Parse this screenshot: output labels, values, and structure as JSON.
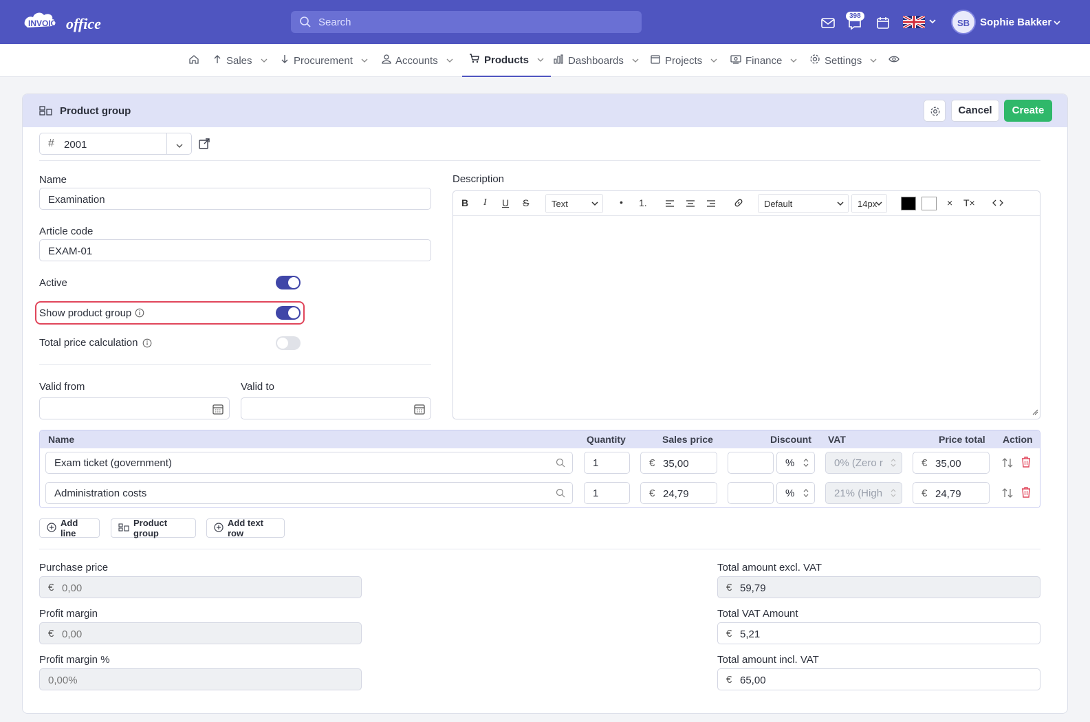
{
  "topbar": {
    "logo_text": "INVOICE office",
    "search_placeholder": "Search",
    "notification_count": "398",
    "user_initials": "SB",
    "user_name": "Sophie Bakker"
  },
  "nav": {
    "items": [
      {
        "label": "Sales"
      },
      {
        "label": "Procurement"
      },
      {
        "label": "Accounts"
      },
      {
        "label": "Products"
      },
      {
        "label": "Dashboards"
      },
      {
        "label": "Projects"
      },
      {
        "label": "Finance"
      },
      {
        "label": "Settings"
      }
    ],
    "active": "Products"
  },
  "card": {
    "title": "Product group",
    "cancel_label": "Cancel",
    "create_label": "Create"
  },
  "form": {
    "number": "2001",
    "name_label": "Name",
    "name_value": "Examination",
    "article_code_label": "Article code",
    "article_code_value": "EXAM-01",
    "active_label": "Active",
    "active_on": true,
    "show_group_label": "Show product group",
    "show_group_on": true,
    "total_price_calc_label": "Total price calculation",
    "total_price_calc_on": false,
    "valid_from_label": "Valid from",
    "valid_from_value": "",
    "valid_to_label": "Valid to",
    "valid_to_value": "",
    "description_label": "Description"
  },
  "editor": {
    "format_select": "Text",
    "font_select": "Default",
    "size_select": "14px",
    "bold": "B",
    "italic": "I",
    "underline": "U",
    "strike": "S",
    "ordered": "1.",
    "clear": "T×",
    "close": "×"
  },
  "lines": {
    "headers": {
      "name": "Name",
      "quantity": "Quantity",
      "sales_price": "Sales price",
      "discount": "Discount",
      "vat": "VAT",
      "price_total": "Price total",
      "action": "Action"
    },
    "rows": [
      {
        "name": "Exam ticket (government)",
        "quantity": "1",
        "sales_price": "35,00",
        "discount": "",
        "discount_unit": "%",
        "vat": "0% (Zero r",
        "price_total": "35,00"
      },
      {
        "name": "Administration costs",
        "quantity": "1",
        "sales_price": "24,79",
        "discount": "",
        "discount_unit": "%",
        "vat": "21% (High",
        "price_total": "24,79"
      }
    ],
    "currency": "€"
  },
  "actions": {
    "add_line": "Add line",
    "product_group": "Product group",
    "add_text_row": "Add text row"
  },
  "totals": {
    "purchase_price_label": "Purchase price",
    "purchase_price": "0,00",
    "profit_margin_label": "Profit margin",
    "profit_margin": "0,00",
    "profit_margin_pct_label": "Profit margin %",
    "profit_margin_pct": "0,00%",
    "total_excl_label": "Total amount excl. VAT",
    "total_excl": "59,79",
    "total_vat_label": "Total VAT Amount",
    "total_vat": "5,21",
    "total_incl_label": "Total amount incl. VAT",
    "total_incl": "65,00"
  },
  "colors": {
    "topbar": "#4f55c0",
    "accent": "#4046a8",
    "create_button": "#2fb86a",
    "delete_icon": "#e0455a",
    "highlight_border": "#e0455a"
  }
}
